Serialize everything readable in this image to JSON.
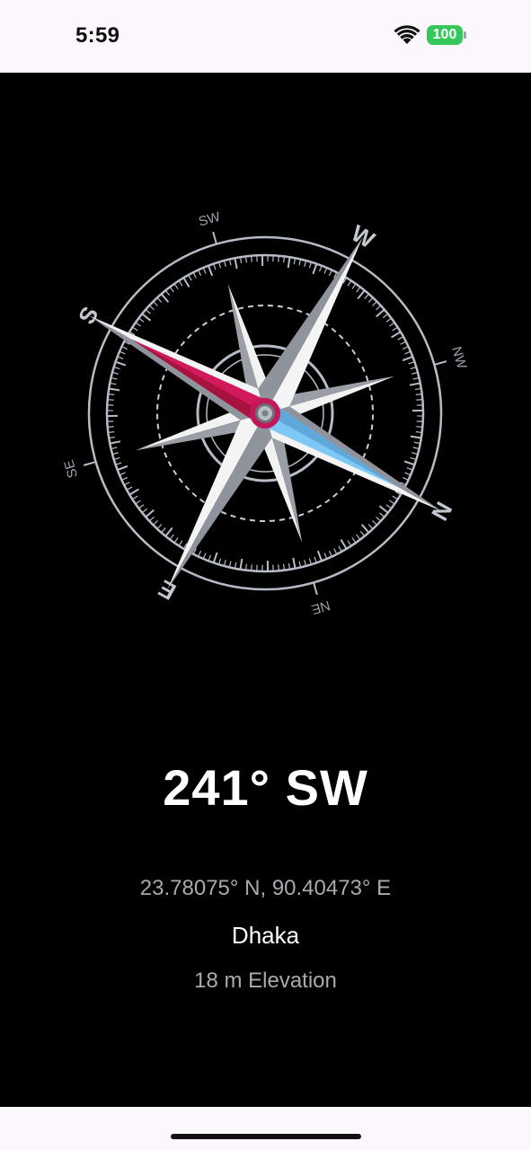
{
  "status_bar": {
    "time": "5:59",
    "battery_level": "100"
  },
  "compass": {
    "cardinal_labels": [
      "N",
      "E",
      "S",
      "W"
    ],
    "intercardinal_labels": [
      "NE",
      "SE",
      "SW",
      "NW"
    ],
    "heading_degrees": 241,
    "accent_colors": {
      "needle_north": "#d11a5b",
      "needle_south": "#7ec8f5"
    }
  },
  "reading": {
    "heading": "241° SW",
    "coordinates": "23.78075° N, 90.40473° E",
    "city": "Dhaka",
    "elevation": "18 m Elevation"
  }
}
